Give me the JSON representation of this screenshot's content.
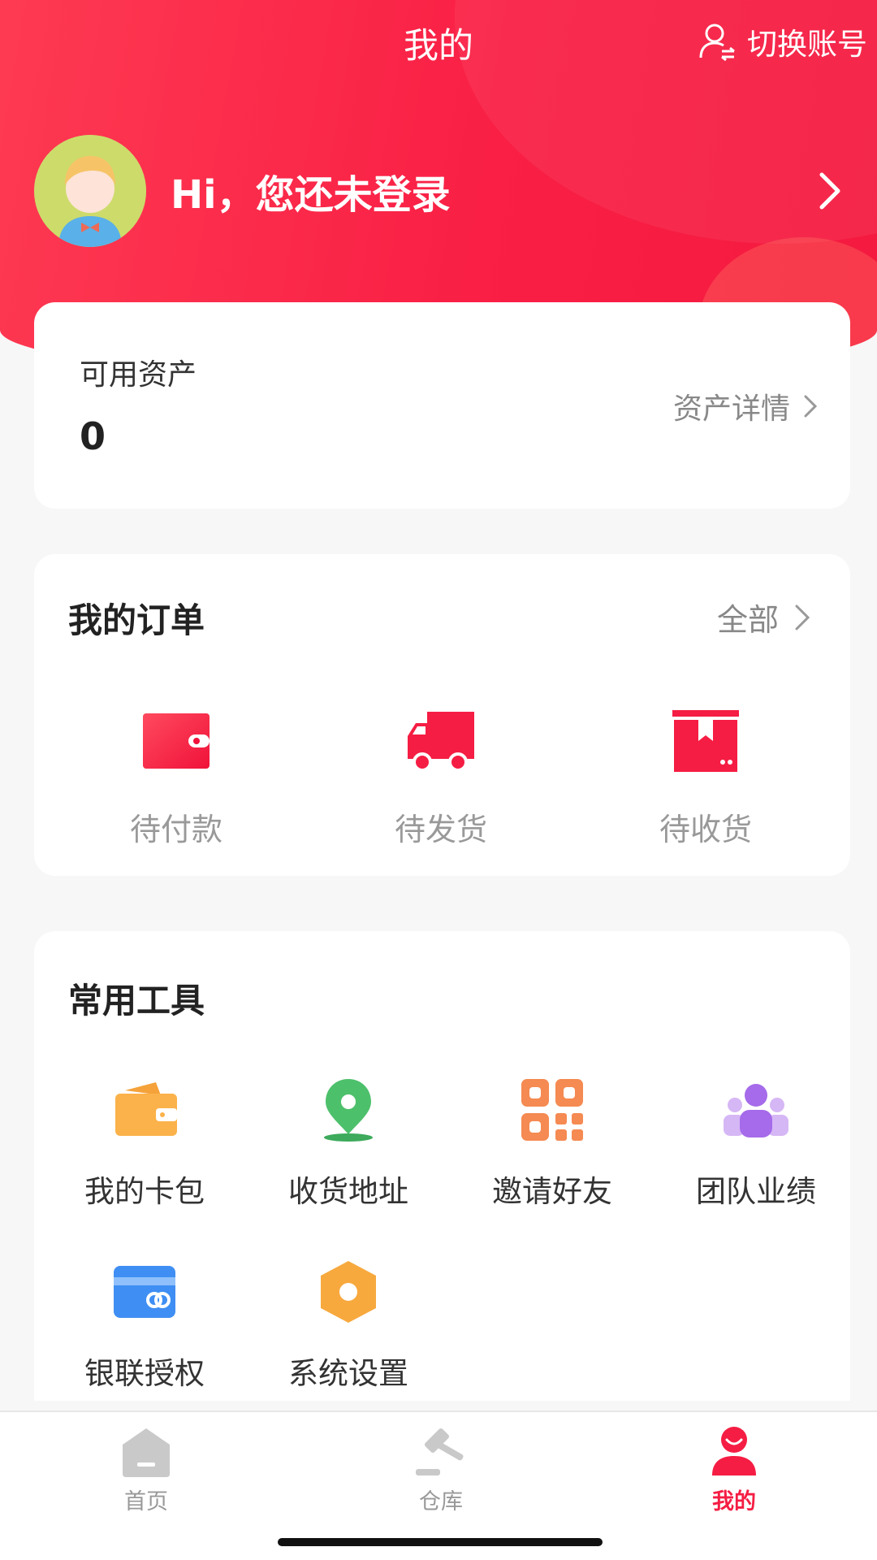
{
  "header": {
    "title": "我的",
    "switch_account_label": "切换账号",
    "greeting": "Hi，您还未登录"
  },
  "assets": {
    "label": "可用资产",
    "value": "0",
    "detail_link": "资产详情"
  },
  "orders": {
    "title": "我的订单",
    "all_label": "全部",
    "items": [
      {
        "label": "待付款",
        "icon": "wallet-icon"
      },
      {
        "label": "待发货",
        "icon": "truck-icon"
      },
      {
        "label": "待收货",
        "icon": "package-icon"
      }
    ]
  },
  "tools": {
    "title": "常用工具",
    "items": [
      {
        "label": "我的卡包",
        "icon": "card-wallet-icon"
      },
      {
        "label": "收货地址",
        "icon": "location-pin-icon"
      },
      {
        "label": "邀请好友",
        "icon": "qr-code-icon"
      },
      {
        "label": "团队业绩",
        "icon": "team-icon"
      },
      {
        "label": "银联授权",
        "icon": "unionpay-card-icon"
      },
      {
        "label": "系统设置",
        "icon": "settings-hexagon-icon"
      }
    ]
  },
  "tabbar": {
    "items": [
      {
        "label": "首页",
        "icon": "home-icon"
      },
      {
        "label": "仓库",
        "icon": "auction-hammer-icon"
      },
      {
        "label": "我的",
        "icon": "user-icon"
      }
    ],
    "active_index": 2
  },
  "colors": {
    "brand_red": "#f51d43",
    "muted_text": "#999999"
  }
}
